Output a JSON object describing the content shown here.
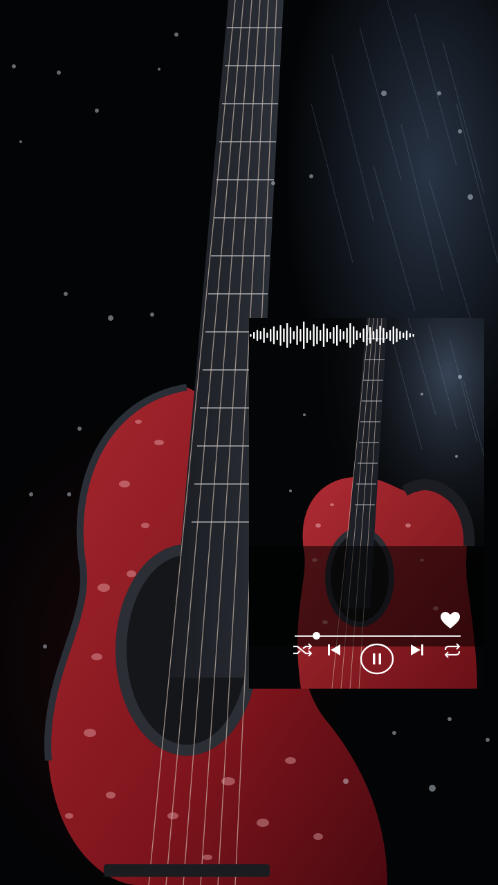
{
  "player": {
    "progress_fraction": 0.13,
    "is_playing": true,
    "is_liked": true
  },
  "icons": {
    "shuffle": "shuffle-icon",
    "previous": "skip-previous-icon",
    "play_pause": "pause-icon",
    "next": "skip-next-icon",
    "repeat": "repeat-icon",
    "like": "heart-icon"
  },
  "colors": {
    "guitar_red": "#8e1b22",
    "control_white": "#ffffff",
    "background": "#030405"
  }
}
